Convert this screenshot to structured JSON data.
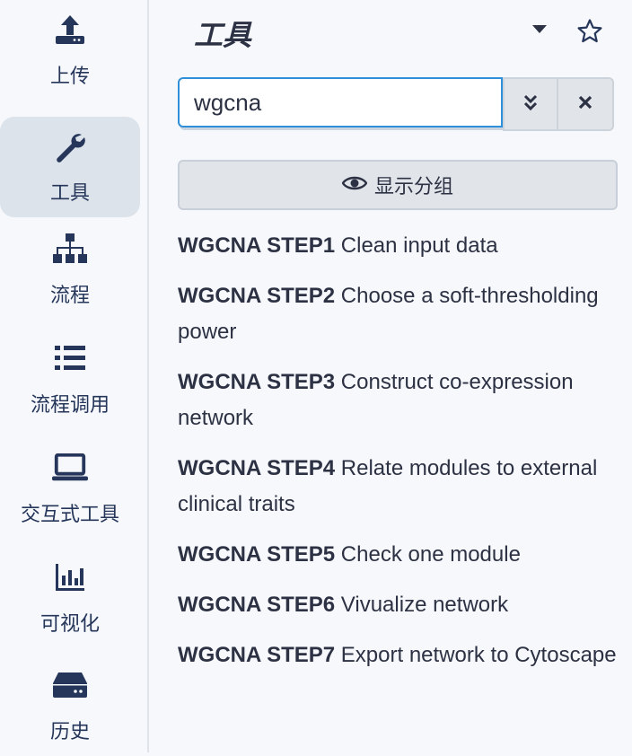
{
  "sidebar": {
    "items": [
      {
        "label": "上传",
        "icon": "upload-icon"
      },
      {
        "label": "工具",
        "icon": "wrench-icon"
      },
      {
        "label": "流程",
        "icon": "sitemap-icon"
      },
      {
        "label": "流程调用",
        "icon": "list-icon"
      },
      {
        "label": "交互式工具",
        "icon": "laptop-icon"
      },
      {
        "label": "可视化",
        "icon": "chart-icon"
      },
      {
        "label": "历史",
        "icon": "hdd-icon"
      }
    ],
    "active": "工具"
  },
  "panel": {
    "title": "工具",
    "search": {
      "value": "wgcna"
    },
    "group_button": "显示分组",
    "tools": [
      {
        "name": "WGCNA STEP1",
        "desc": "Clean input data"
      },
      {
        "name": "WGCNA STEP2",
        "desc": "Choose a soft-thresholding power"
      },
      {
        "name": "WGCNA STEP3",
        "desc": "Construct co-expression network"
      },
      {
        "name": "WGCNA STEP4",
        "desc": "Relate modules to external clinical traits"
      },
      {
        "name": "WGCNA STEP5",
        "desc": "Check one module"
      },
      {
        "name": "WGCNA STEP6",
        "desc": "Vivualize network"
      },
      {
        "name": "WGCNA STEP7",
        "desc": "Export network to Cytoscape"
      }
    ]
  },
  "colors": {
    "accent": "#2f8fd8",
    "icon": "#25365a",
    "active_bg": "#dde3ea"
  }
}
